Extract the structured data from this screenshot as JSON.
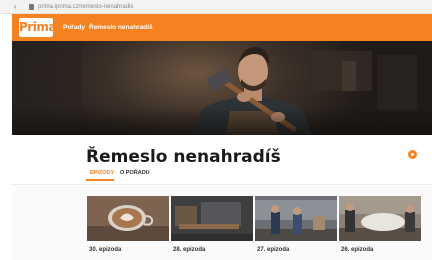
{
  "browser": {
    "url": "prima.iprima.cz/remeslo-nenahradis"
  },
  "topnav": {
    "logo_text": "Prima",
    "links": [
      "Pořady",
      "Řemeslo nenahradíš"
    ]
  },
  "show": {
    "title": "Řemeslo nenahradíš",
    "tabs": [
      "EPIZODY",
      "O POŘADU"
    ],
    "active_tab": "EPIZODY"
  },
  "episodes": [
    {
      "label": "30. epizoda"
    },
    {
      "label": "28. epizoda"
    },
    {
      "label": "27. epizoda"
    },
    {
      "label": "26. epizoda"
    }
  ],
  "colors": {
    "brand": "#f58220",
    "title": "#1a1a1a"
  }
}
